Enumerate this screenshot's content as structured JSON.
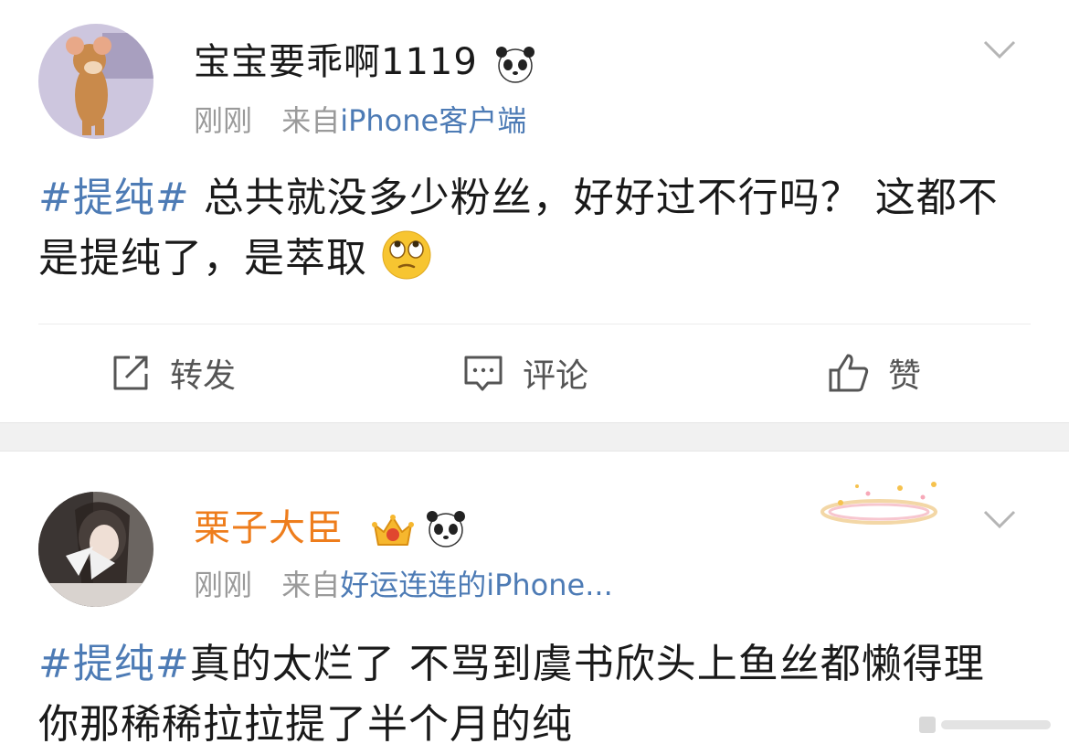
{
  "posts": [
    {
      "username": "宝宝要乖啊1119",
      "time": "刚刚",
      "source_prefix": "来自",
      "source": "iPhone客户端",
      "hashtag": "#提纯#",
      "text": " 总共就没多少粉丝，好好过不行吗？ 这都不是提纯了，是萃取",
      "badges": [
        "panda-icon"
      ],
      "emoji": "eye-roll-emoji"
    },
    {
      "username": "栗子大臣",
      "time": "刚刚",
      "source_prefix": "来自",
      "source": "好运连连的iPhone...",
      "hashtag": "#提纯#",
      "text": "真的太烂了 不骂到虞书欣头上鱼丝都懒得理你那稀稀拉拉提了半个月的纯",
      "badges": [
        "crown-badge-icon",
        "panda-icon"
      ]
    }
  ],
  "actions": {
    "repost": "转发",
    "comment": "评论",
    "like": "赞"
  },
  "colors": {
    "link": "#4d7bb5",
    "vip_name": "#ee7d1c",
    "meta": "#9a9a9a",
    "separator": "#f1f1f1"
  }
}
